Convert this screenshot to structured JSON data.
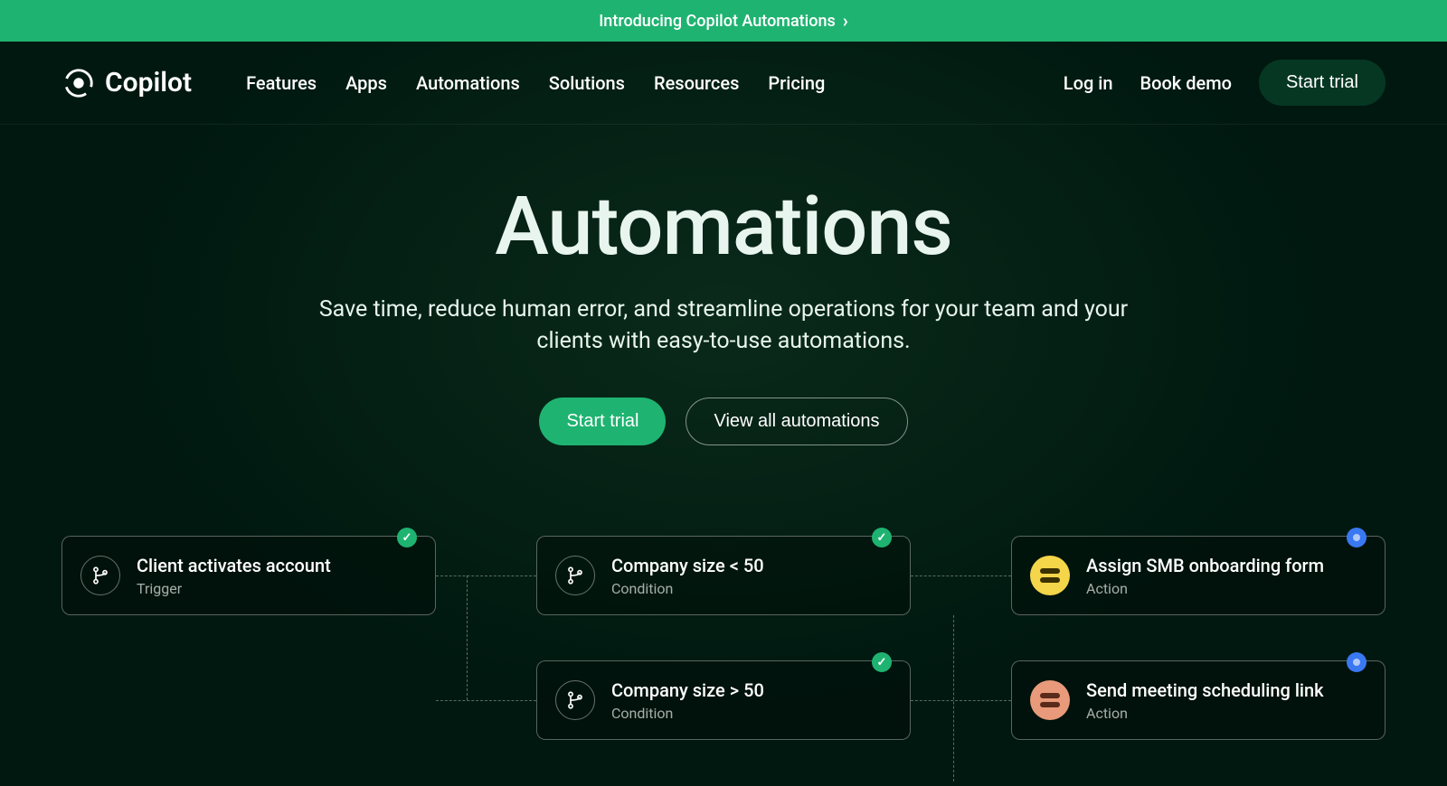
{
  "banner": {
    "text": "Introducing Copilot Automations"
  },
  "brand": "Copilot",
  "nav": {
    "features": "Features",
    "apps": "Apps",
    "automations": "Automations",
    "solutions": "Solutions",
    "resources": "Resources",
    "pricing": "Pricing"
  },
  "headerActions": {
    "login": "Log in",
    "bookDemo": "Book demo",
    "startTrial": "Start trial"
  },
  "hero": {
    "title": "Automations",
    "subtitle": "Save time, reduce human error, and streamline operations for your team and your clients with easy-to-use automations.",
    "ctaPrimary": "Start trial",
    "ctaSecondary": "View all automations"
  },
  "flow": {
    "trigger": {
      "title": "Client activates account",
      "type": "Trigger"
    },
    "cond1": {
      "title": "Company size < 50",
      "type": "Condition"
    },
    "cond2": {
      "title": "Company size > 50",
      "type": "Condition"
    },
    "action1": {
      "title": "Assign SMB onboarding form",
      "type": "Action"
    },
    "action2": {
      "title": "Send meeting scheduling link",
      "type": "Action"
    }
  }
}
